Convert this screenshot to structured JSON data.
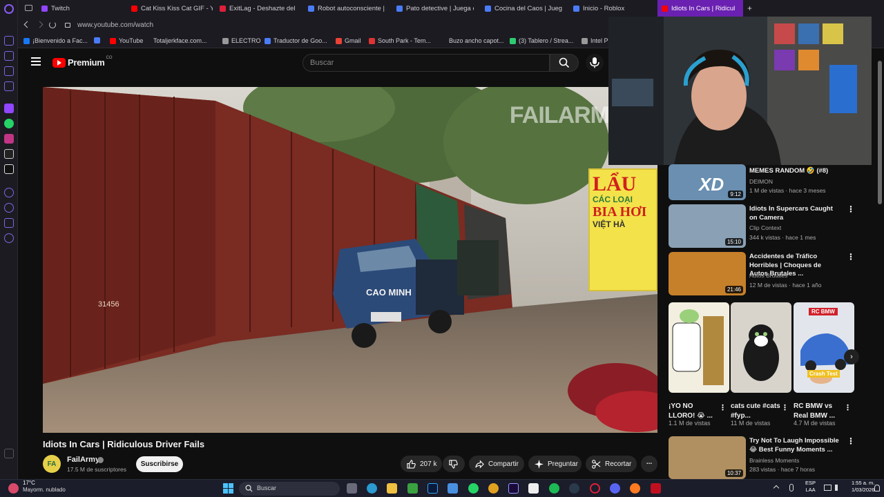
{
  "browser": {
    "tabs": [
      {
        "label": "Twitch",
        "color": "#9146ff"
      },
      {
        "label": "Cat Kiss Kiss Cat GIF - Yo",
        "color": "#ff0000"
      },
      {
        "label": "ExitLag - Deshazte del lag",
        "color": "#e0203a"
      },
      {
        "label": "Robot autoconsciente | Ju",
        "color": "#4a7cf7"
      },
      {
        "label": "Pato detective | Juega en",
        "color": "#4a7cf7"
      },
      {
        "label": "Cocina del Caos | Juega e",
        "color": "#4a7cf7"
      },
      {
        "label": "Inicio - Roblox",
        "color": "#4a7cf7"
      }
    ],
    "active_tab": {
      "label": "Idiots In Cars | Ridicul",
      "color": "#ff0000"
    },
    "new_tab": "+",
    "url": "www.youtube.com/watch",
    "bookmarks": [
      {
        "label": "¡Bienvenido a Fac...",
        "color": "#1877f2"
      },
      {
        "label": "",
        "color": "#4a7cf7"
      },
      {
        "label": "YouTube",
        "color": "#ff0000"
      },
      {
        "label": "Totaljerkface.com...",
        "color": ""
      },
      {
        "label": "ELECTRO",
        "color": "#999"
      },
      {
        "label": "Traductor de Goo...",
        "color": "#4a7cf7"
      },
      {
        "label": "Gmail",
        "color": "#ea4335"
      },
      {
        "label": "South Park - Tem...",
        "color": "#d33"
      },
      {
        "label": "Buzo ancho capot...",
        "color": ""
      },
      {
        "label": "(3) Tablero / Strea...",
        "color": "#2ecc71"
      },
      {
        "label": "Intel Pl",
        "color": "#999"
      }
    ]
  },
  "youtube": {
    "logo_word": "Premium",
    "logo_region": "CO",
    "search_placeholder": "Buscar",
    "video": {
      "title": "Idiots In Cars | Ridiculous Driver Fails",
      "watermark": "FAILARM",
      "sign_line1": "LẨU",
      "sign_line2": "CÁC LOẠI",
      "sign_line3": "BIA HƠI",
      "sign_line4": "VIỆT HÀ",
      "truck_text": "CAO MINH",
      "car_number": "31456"
    },
    "channel": {
      "avatar_text": "FA",
      "name": "FailArmy",
      "subscribers": "17.5 M de suscriptores",
      "subscribe_label": "Suscribirse"
    },
    "actions": {
      "likes": "207 k",
      "share": "Compartir",
      "ask": "Preguntar",
      "clip": "Recortar",
      "more": "..."
    },
    "recommendations": [
      {
        "title": "MEMES RANDOM 🤣 (#8)",
        "channel": "DEIMON",
        "meta": "1 M de vistas · hace 3 meses",
        "duration": "9:12",
        "thumb_color": "#6a8fb0",
        "thumb_text": "XD"
      },
      {
        "title": "Idiots In Supercars Caught on Camera",
        "channel": "Clip Context",
        "meta": "344 k vistas · hace 1 mes",
        "duration": "15:10",
        "thumb_color": "#8aa0b4",
        "thumb_text": ""
      },
      {
        "title": "Accidentes de Tráfico Horribles | Choques de Autos Brutales ...",
        "channel": "Autos Brutales",
        "meta": "12 M de vistas · hace 1 año",
        "duration": "21:46",
        "thumb_color": "#c7802a",
        "thumb_text": ""
      }
    ],
    "shorts": [
      {
        "title": "¡YO NO LLORO! 😭 ...",
        "views": "1.1 M de vistas",
        "thumb_color": "#f2efe0"
      },
      {
        "title": "cats cute #cats #fyp...",
        "views": "11 M de vistas",
        "thumb_color": "#d8d4cc"
      },
      {
        "title": "RC BMW vs Real BMW ...",
        "views": "4.7 M de vistas",
        "thumb_color": "#e2e6ec",
        "badge": "RC BMW",
        "tag": "Crash Test"
      }
    ],
    "bottom_rec": {
      "title": "Try Not To Laugh Impossible 😂 Best Funny Moments ...",
      "channel": "Brainless Moments",
      "meta": "283 vistas · hace 7 horas",
      "duration": "10:37"
    }
  },
  "taskbar": {
    "weather_temp": "17°C",
    "weather_desc": "Mayorm. nublado",
    "search_label": "Buscar",
    "lang1": "ESP",
    "lang2": "LAA",
    "time": "1:55 a. m.",
    "date": "1/03/2026"
  }
}
